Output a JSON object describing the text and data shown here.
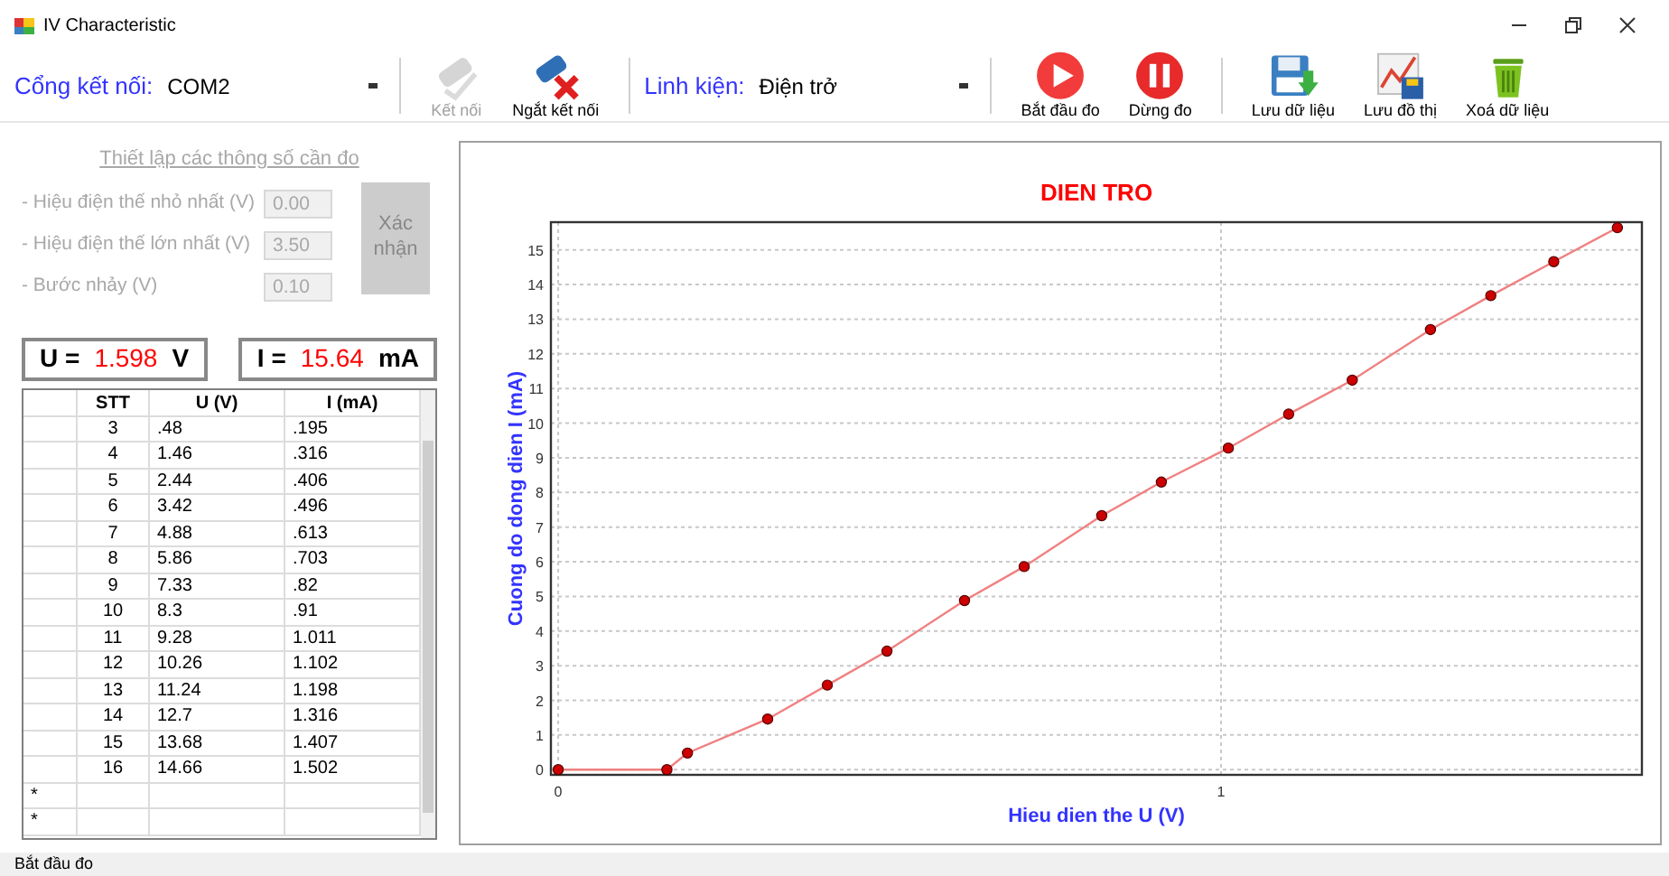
{
  "window": {
    "title": "IV Characteristic"
  },
  "toolbar": [
    {
      "kind": "combo",
      "label": "Cổng kết nối:",
      "value": "COM2"
    },
    {
      "kind": "separator"
    },
    {
      "kind": "button",
      "label": "Kết nối",
      "disabled": true
    },
    {
      "kind": "button",
      "label": "Ngắt kết nối",
      "disabled": false
    },
    {
      "kind": "separator"
    },
    {
      "kind": "combo",
      "label": "Linh kiện:",
      "value": "Điện trở"
    },
    {
      "kind": "separator"
    },
    {
      "kind": "button",
      "label": "Bắt đầu đo",
      "disabled": false
    },
    {
      "kind": "button",
      "label": "Dừng đo",
      "disabled": false
    },
    {
      "kind": "separator"
    },
    {
      "kind": "button",
      "label": "Lưu dữ liệu",
      "disabled": false
    },
    {
      "kind": "button",
      "label": "Lưu đồ thị",
      "disabled": false
    },
    {
      "kind": "button",
      "label": "Xoá dữ liệu",
      "disabled": false
    }
  ],
  "settings": {
    "title": "Thiết lập các thông số cần đo",
    "disabled": true,
    "fields": [
      {
        "label": "- Hiệu điện thế nhỏ nhất (V)",
        "value": "0.00"
      },
      {
        "label": "- Hiệu điện thế lớn nhất (V)",
        "value": "3.50"
      },
      {
        "label": "- Bước nhảy (V)",
        "value": "0.10"
      }
    ],
    "confirm": {
      "label": "Xác nhận",
      "disabled": true
    }
  },
  "readings": [
    {
      "name": "U =",
      "value": "1.598",
      "unit": "V"
    },
    {
      "name": "I =",
      "value": "15.64",
      "unit": "mA"
    }
  ],
  "table": {
    "columns": [
      "STT",
      "U (V)",
      "I (mA)"
    ],
    "rows": [
      [
        "3",
        ".48",
        ".195"
      ],
      [
        "4",
        "1.46",
        ".316"
      ],
      [
        "5",
        "2.44",
        ".406"
      ],
      [
        "6",
        "3.42",
        ".496"
      ],
      [
        "7",
        "4.88",
        ".613"
      ],
      [
        "8",
        "5.86",
        ".703"
      ],
      [
        "9",
        "7.33",
        ".82"
      ],
      [
        "10",
        "8.3",
        ".91"
      ],
      [
        "11",
        "9.28",
        "1.011"
      ],
      [
        "12",
        "10.26",
        "1.102"
      ],
      [
        "13",
        "11.24",
        "1.198"
      ],
      [
        "14",
        "12.7",
        "1.316"
      ],
      [
        "15",
        "13.68",
        "1.407"
      ],
      [
        "16",
        "14.66",
        "1.502"
      ]
    ],
    "new_row_markers": [
      "*",
      "*"
    ]
  },
  "chart": {
    "chart_data": {
      "type": "line",
      "title": "DIEN TRO",
      "xlabel": "Hieu dien the U (V)",
      "ylabel": "Cuong do dong dien I (mA)",
      "x": [
        0,
        0.164,
        0.195,
        0.316,
        0.406,
        0.496,
        0.613,
        0.703,
        0.82,
        0.91,
        1.011,
        1.102,
        1.198,
        1.316,
        1.407,
        1.502,
        1.598
      ],
      "grid": true,
      "series": [
        {
          "color": "#cc0000",
          "marker": "o",
          "values": [
            0,
            0,
            0.48,
            1.46,
            2.44,
            3.42,
            4.88,
            5.86,
            7.33,
            8.3,
            9.28,
            10.26,
            11.24,
            12.7,
            13.68,
            14.66,
            15.64
          ]
        }
      ],
      "xlim": [
        -0.011,
        1.635
      ],
      "ylim": [
        -0.15,
        15.8
      ],
      "xticks": [
        0,
        1
      ],
      "yticks": [
        0,
        1,
        2,
        3,
        4,
        5,
        6,
        7,
        8,
        9,
        10,
        11,
        12,
        13,
        14,
        15
      ]
    }
  },
  "status_bar": {
    "text": "Bắt đầu đo"
  }
}
